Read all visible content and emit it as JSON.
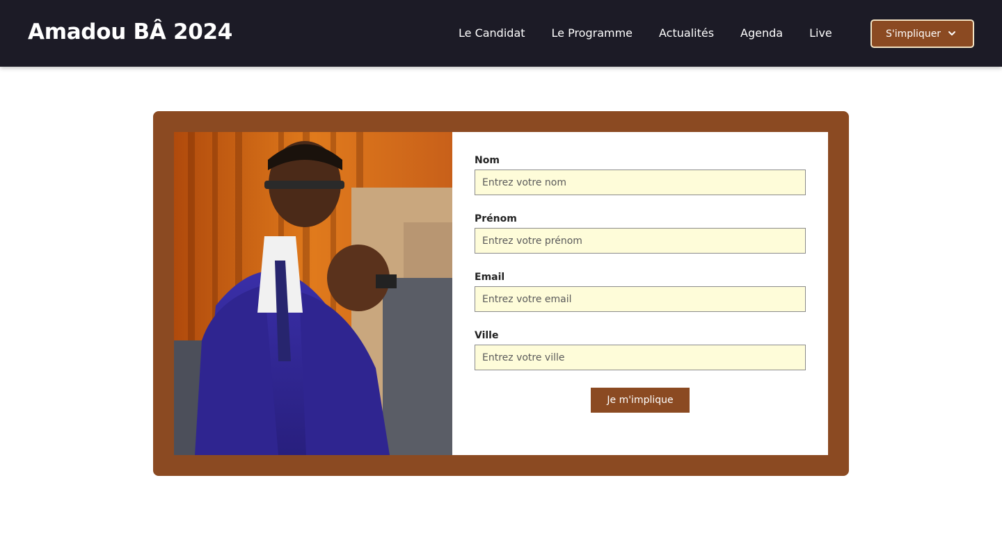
{
  "header": {
    "brand": "Amadou BÂ 2024",
    "nav": [
      "Le Candidat",
      "Le Programme",
      "Actualités",
      "Agenda",
      "Live"
    ],
    "cta_label": "S'impliquer",
    "cta_icon": "chevron-down-icon"
  },
  "form": {
    "fields": [
      {
        "label": "Nom",
        "placeholder": "Entrez votre nom"
      },
      {
        "label": "Prénom",
        "placeholder": "Entrez votre prénom"
      },
      {
        "label": "Email",
        "placeholder": "Entrez votre email"
      },
      {
        "label": "Ville",
        "placeholder": "Entrez votre ville"
      }
    ],
    "submit_label": "Je m'implique"
  },
  "colors": {
    "navbar": "#1c1b26",
    "accent": "#8b4a22",
    "input_bg": "#fefcd9"
  }
}
